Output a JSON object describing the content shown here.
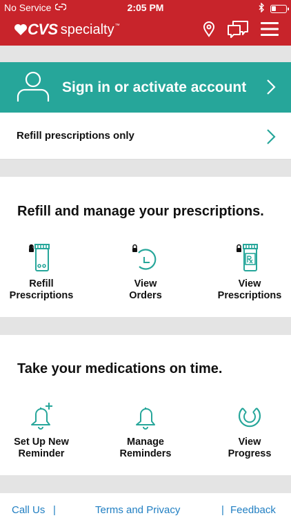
{
  "status_bar": {
    "carrier": "No Service",
    "time": "2:05 PM"
  },
  "header": {
    "brand_main": "CVS",
    "brand_sub": "specialty",
    "brand_tm": "™"
  },
  "signin": {
    "label": "Sign in or activate account"
  },
  "refill_only": {
    "label": "Refill prescriptions only"
  },
  "prescriptions": {
    "title": "Refill and manage your prescriptions.",
    "tiles": [
      {
        "line1": "Refill",
        "line2": "Prescriptions",
        "icon": "prescription-bottle-icon",
        "locked": true
      },
      {
        "line1": "View",
        "line2": "Orders",
        "icon": "order-history-icon",
        "locked": true
      },
      {
        "line1": "View",
        "line2": "Prescriptions",
        "icon": "rx-bottle-icon",
        "locked": true
      }
    ]
  },
  "reminders": {
    "title": "Take your medications on time.",
    "tiles": [
      {
        "line1": "Set Up New",
        "line2": "Reminder",
        "icon": "bell-plus-icon"
      },
      {
        "line1": "Manage",
        "line2": "Reminders",
        "icon": "bell-icon"
      },
      {
        "line1": "View",
        "line2": "Progress",
        "icon": "progress-ring-icon"
      }
    ]
  },
  "footer": {
    "call_us": "Call Us",
    "sep1": "|",
    "terms": "Terms and Privacy",
    "sep2": "|",
    "feedback": "Feedback"
  },
  "colors": {
    "brand_red": "#c8242b",
    "teal": "#26a69a",
    "link_blue": "#1f7ec2",
    "gap_gray": "#e4e4e4"
  }
}
